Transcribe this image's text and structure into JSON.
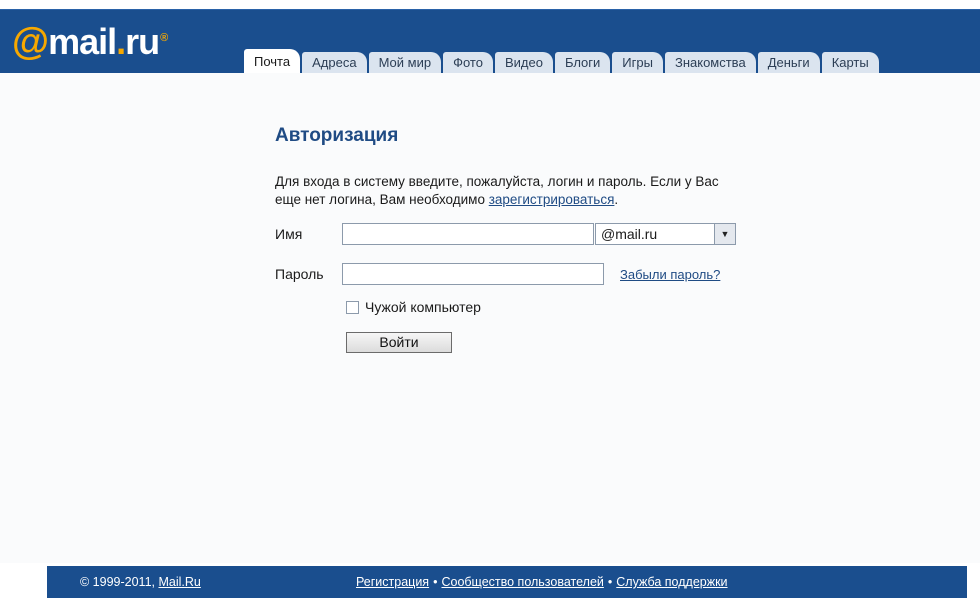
{
  "header": {
    "logo": {
      "at": "@",
      "name": "mail",
      "dot": ".",
      "tld": "ru",
      "reg": "®"
    },
    "tabs": [
      {
        "label": "Почта",
        "active": true
      },
      {
        "label": "Адреса",
        "active": false
      },
      {
        "label": "Мой мир",
        "active": false
      },
      {
        "label": "Фото",
        "active": false
      },
      {
        "label": "Видео",
        "active": false
      },
      {
        "label": "Блоги",
        "active": false
      },
      {
        "label": "Игры",
        "active": false
      },
      {
        "label": "Знакомства",
        "active": false
      },
      {
        "label": "Деньги",
        "active": false
      },
      {
        "label": "Карты",
        "active": false
      }
    ]
  },
  "login": {
    "title": "Авторизация",
    "intro_text": "Для входа в систему введите, пожалуйста, логин и пароль. Если у Вас еще нет логина, Вам необходимо ",
    "register_link": "зарегистрироваться",
    "intro_end": ".",
    "name_label": "Имя",
    "name_value": "",
    "domain_selected": "@mail.ru",
    "password_label": "Пароль",
    "password_value": "",
    "forgot_link": "Забыли пароль?",
    "foreign_computer_label": "Чужой компьютер",
    "submit_label": "Войти"
  },
  "footer": {
    "copyright_prefix": "© 1999-2011, ",
    "copyright_link": "Mail.Ru",
    "links": [
      "Регистрация",
      "Сообщество пользователей",
      "Служба поддержки"
    ],
    "separator": "•"
  },
  "colors": {
    "header_blue": "#1a4e8e",
    "logo_orange": "#f7a800",
    "title_blue": "#1f4b84"
  }
}
